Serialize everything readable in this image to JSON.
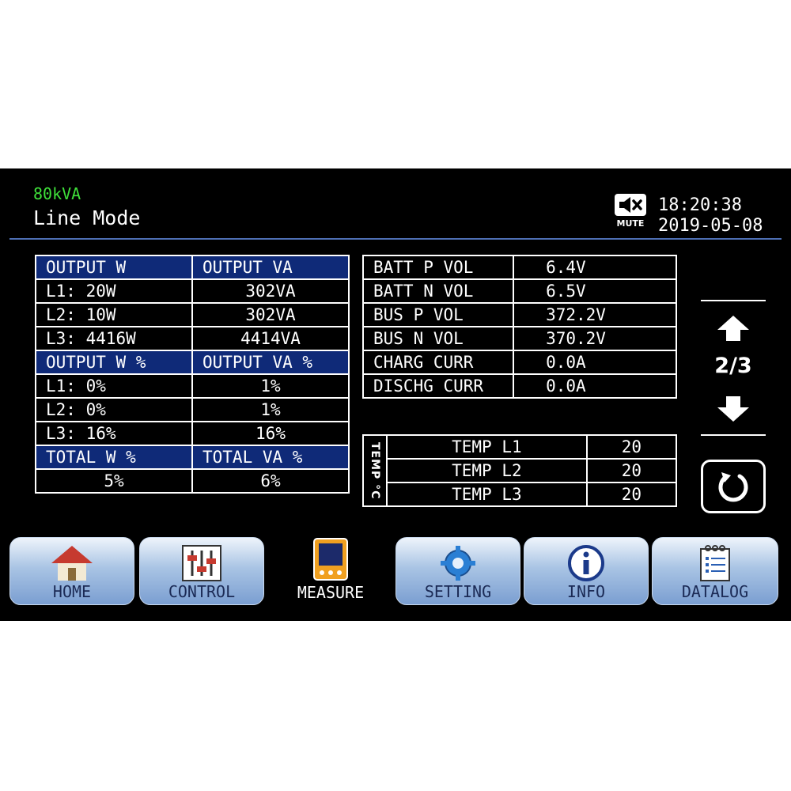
{
  "header": {
    "model": "80kVA",
    "mode": "Line Mode",
    "mute_label": "MUTE",
    "time": "18:20:38",
    "date": "2019-05-08"
  },
  "output_table": {
    "rows": [
      {
        "a": "OUTPUT W",
        "b": "OUTPUT VA",
        "header": true
      },
      {
        "a": "L1: 20W",
        "b": "302VA"
      },
      {
        "a": "L2: 10W",
        "b": "302VA"
      },
      {
        "a": "L3: 4416W",
        "b": "4414VA"
      },
      {
        "a": "OUTPUT W %",
        "b": "OUTPUT VA %",
        "header": true
      },
      {
        "a": "L1:   0%",
        "b": "1%"
      },
      {
        "a": "L2:   0%",
        "b": "1%"
      },
      {
        "a": "L3:  16%",
        "b": "16%"
      },
      {
        "a": "TOTAL W %",
        "b": "TOTAL VA %",
        "header": true
      },
      {
        "a": "5%",
        "b": "6%",
        "center": true
      }
    ]
  },
  "battery_table": {
    "rows": [
      {
        "label": "BATT P VOL",
        "value": "6.4V"
      },
      {
        "label": "BATT N VOL",
        "value": "6.5V"
      },
      {
        "label": "BUS P VOL",
        "value": "372.2V"
      },
      {
        "label": "BUS N VOL",
        "value": "370.2V"
      },
      {
        "label": "CHARG CURR",
        "value": "0.0A"
      },
      {
        "label": "DISCHG CURR",
        "value": "0.0A"
      }
    ]
  },
  "temp_table": {
    "side_label": "TEMP °C",
    "rows": [
      {
        "label": "TEMP L1",
        "value": "20"
      },
      {
        "label": "TEMP L2",
        "value": "20"
      },
      {
        "label": "TEMP L3",
        "value": "20"
      }
    ]
  },
  "pager": {
    "current": "2/3"
  },
  "nav": {
    "home": "HOME",
    "control": "CONTROL",
    "measure": "MEASURE",
    "setting": "SETTING",
    "info": "INFO",
    "datalog": "DATALOG"
  },
  "colors": {
    "model_text": "#3fe03a",
    "table_header": "#0f2a78",
    "divider": "#4e6fb4"
  },
  "icons": {
    "mute": "speaker-mute-icon",
    "up": "arrow-up-icon",
    "down": "arrow-down-icon",
    "refresh": "refresh-icon",
    "home": "home-icon",
    "control": "sliders-icon",
    "measure": "meter-icon",
    "setting": "gear-icon",
    "info": "info-icon",
    "datalog": "notepad-icon"
  }
}
